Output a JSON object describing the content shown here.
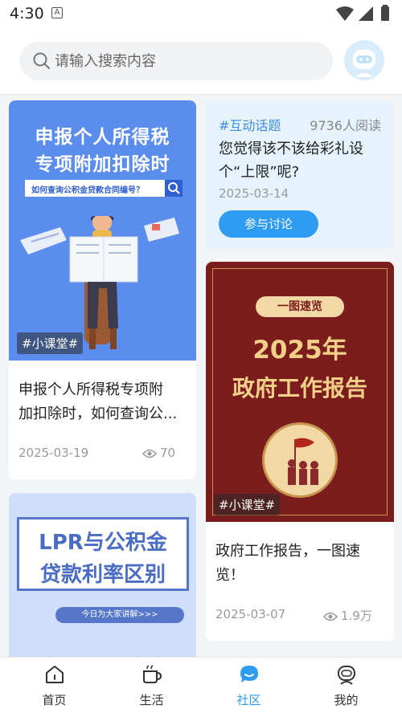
{
  "status": {
    "time": "4:30",
    "notif_icon": "a-icon"
  },
  "search": {
    "placeholder": "请输入搜索内容",
    "value": ""
  },
  "feed": {
    "card1": {
      "poster_line1": "申报个人所得税",
      "poster_line2": "专项附加扣除时",
      "poster_query": "如何查询公积金贷款合同编号？",
      "tag": "#小课堂#",
      "title_line1": "申报个人所得税专项附",
      "title_line2": "加扣除时，如何查询公...",
      "date": "2025-03-19",
      "views": "70"
    },
    "topic": {
      "hashtag": "#互动话题",
      "reads": "9736人阅读",
      "question": "您觉得该不该给彩礼设个“上限”呢?",
      "date": "2025-03-14",
      "button": "参与讨论"
    },
    "card2": {
      "poster_pill": "一图速览",
      "poster_year": "2025年",
      "poster_title": "政府工作报告",
      "tag": "#小课堂#",
      "title_line1": "政府工作报告，一图速",
      "title_line2": "览！",
      "date": "2025-03-07",
      "views": "1.9万"
    },
    "card3": {
      "poster_line1": "LPR与公积金",
      "poster_line2": "贷款利率区别",
      "poster_bar": "今日为大家讲解>>>"
    }
  },
  "tabs": [
    {
      "label": "首页",
      "icon": "home-icon"
    },
    {
      "label": "生活",
      "icon": "cup-icon"
    },
    {
      "label": "社区",
      "icon": "chat-bubble-icon",
      "active": true
    },
    {
      "label": "我的",
      "icon": "robot-face-icon"
    }
  ],
  "colors": {
    "accent": "#2f9bf1",
    "report_red": "#7b1d1d",
    "poster_blue": "#5b8def"
  }
}
